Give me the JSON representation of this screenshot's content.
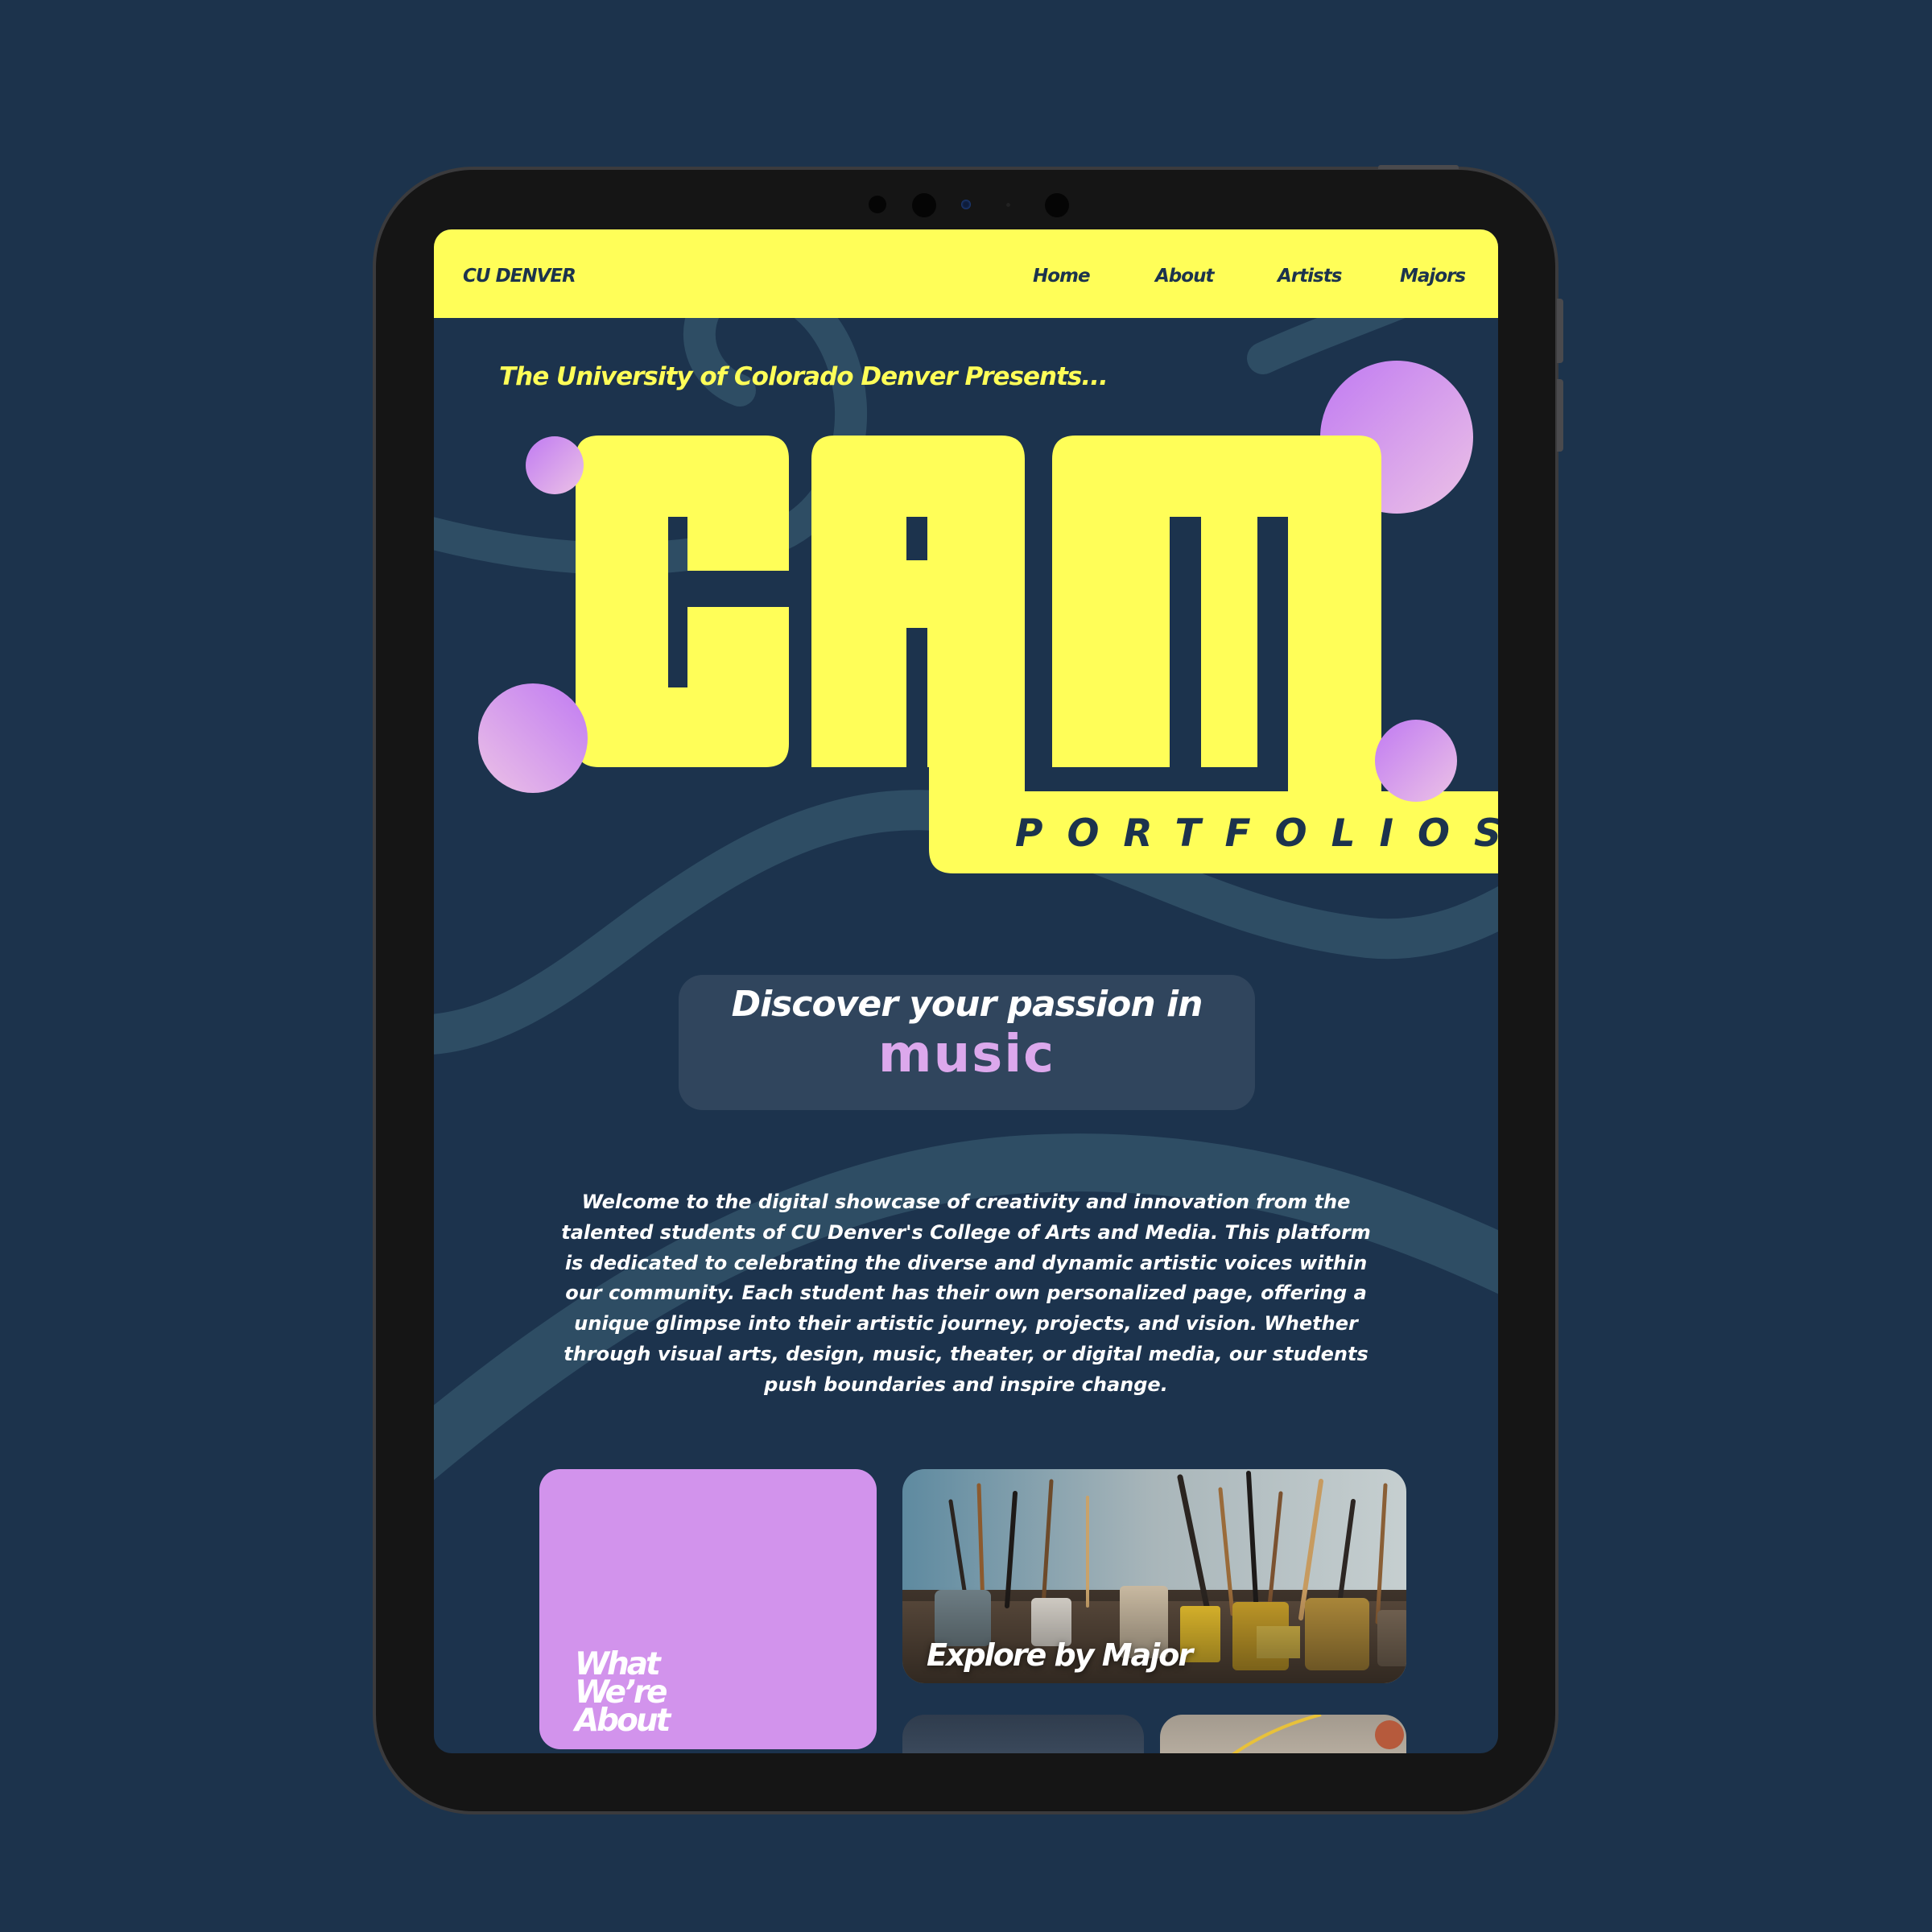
{
  "nav": {
    "brand": "CU DENVER",
    "links": [
      "Home",
      "About",
      "Artists",
      "Majors"
    ]
  },
  "hero": {
    "presents": "The University of Colorado Denver Presents...",
    "logo_text": "CAM",
    "subtitle": "PORTFOLIOS"
  },
  "discover": {
    "line": "Discover your passion in",
    "word": "music"
  },
  "welcome": {
    "text": "Welcome to the digital showcase of creativity and innovation from the talented students of CU Denver's College of Arts and Media. This platform is dedicated to celebrating the diverse and dynamic artistic voices within our community. Each student has their own personalized page, offering a unique glimpse into their artistic journey, projects, and vision. Whether through visual arts, design, music, theater, or digital media, our students push boundaries and inspire change."
  },
  "cards": {
    "about_lines": [
      "What",
      "We’re",
      "About"
    ],
    "major_title": "Explore by Major"
  },
  "colors": {
    "page_background": "#1c334c",
    "screen_background": "#1c334d",
    "accent_yellow": "#fffe58",
    "purple_card": "#d293ec",
    "music_pink": "#dca8ec",
    "wave": "#2e4d64",
    "bubble_gradient": [
      "#c07af2",
      "#ecc2e6"
    ]
  },
  "icons": {
    "tablet_cameras": "camera-lens-icon"
  }
}
